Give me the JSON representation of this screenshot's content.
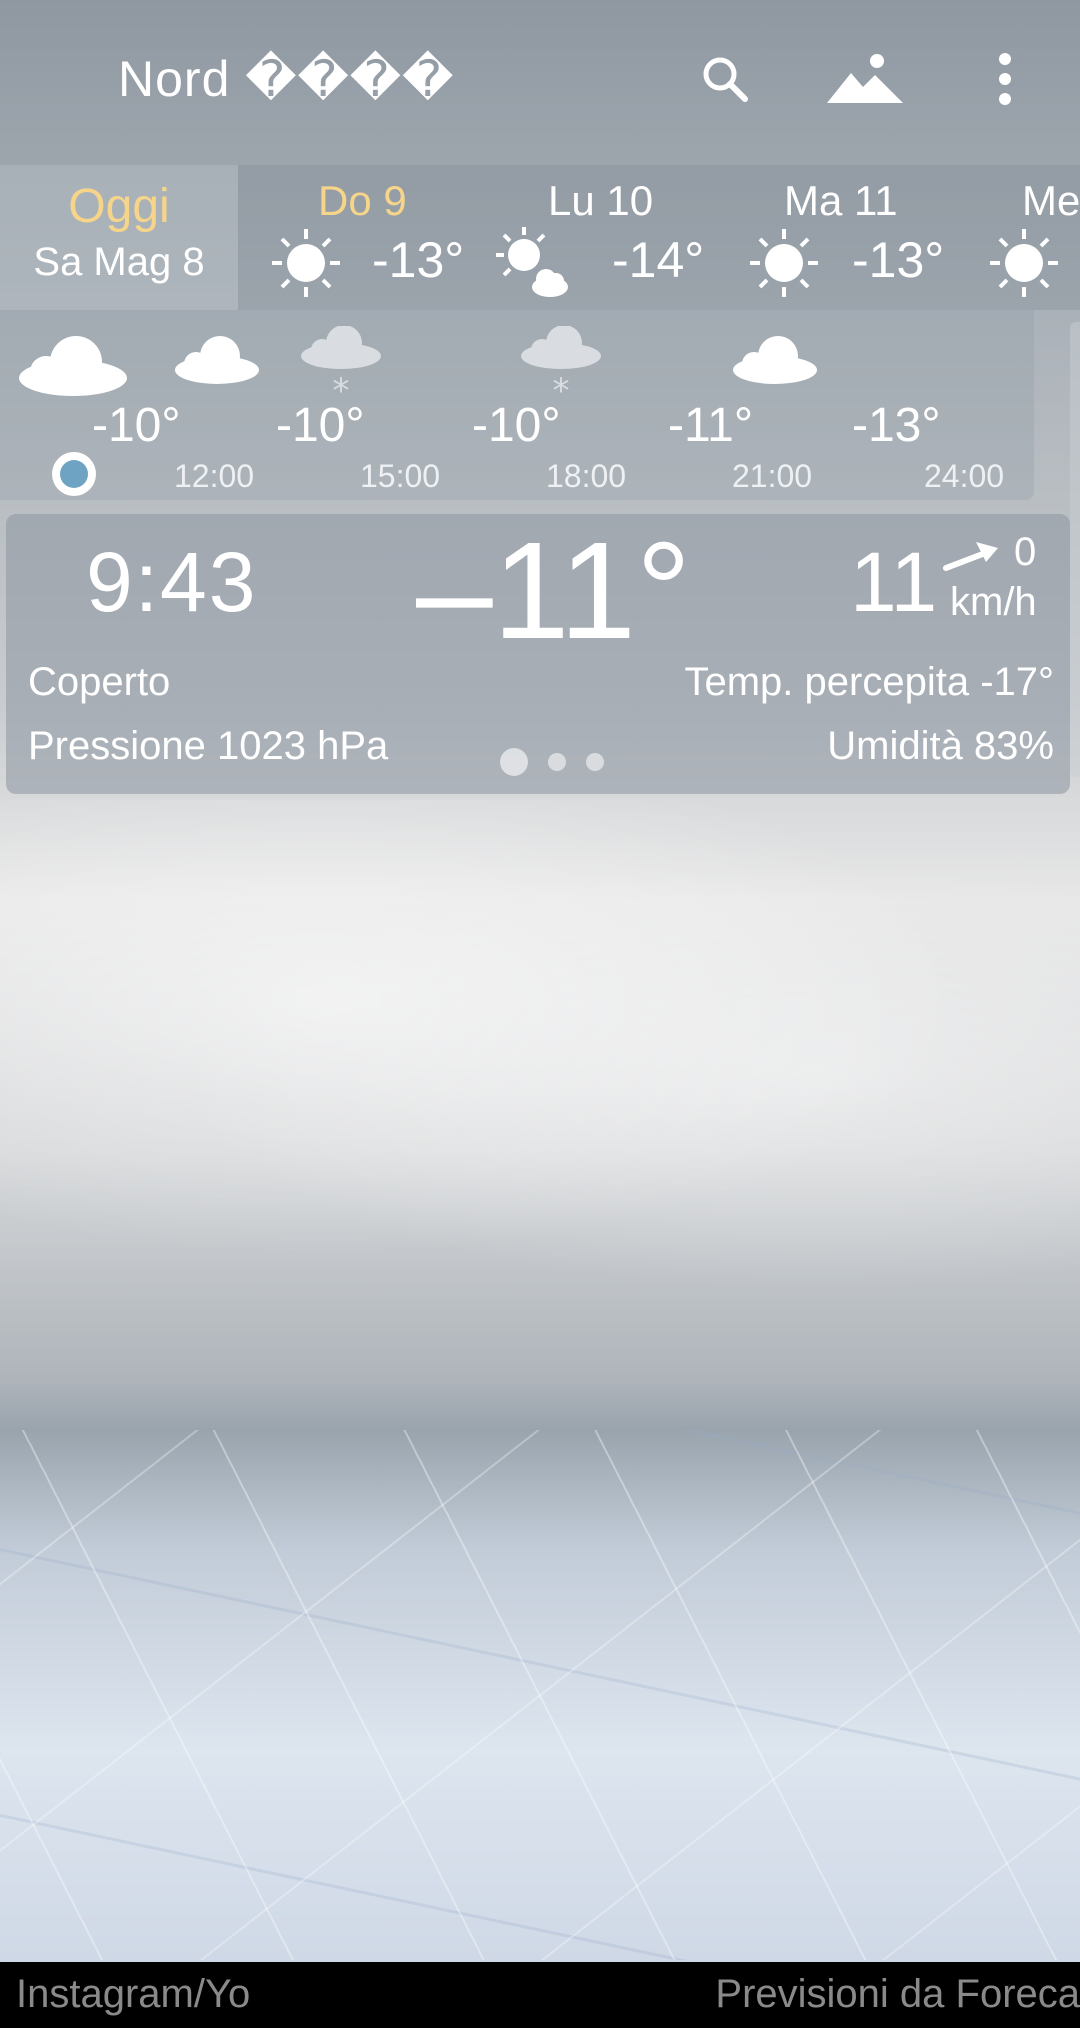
{
  "header": {
    "title": "Nord ����",
    "search_icon": "search-icon",
    "landscape_icon": "landscape-icon",
    "more_icon": "more-vert-icon"
  },
  "daily": {
    "today": {
      "label": "Oggi",
      "date": "Sa Mag 8"
    },
    "days": [
      {
        "name": "Do 9",
        "icon": "sun-icon",
        "temp": "-13°",
        "highlight": true
      },
      {
        "name": "Lu 10",
        "icon": "sun-cloud-icon",
        "temp": "-14°"
      },
      {
        "name": "Ma 11",
        "icon": "sun-icon",
        "temp": "-13°"
      },
      {
        "name": "Me",
        "icon": "sun-icon",
        "temp": ""
      }
    ]
  },
  "hourly": {
    "temps": [
      "-10°",
      "-10°",
      "-10°",
      "-11°",
      "-13°"
    ],
    "times": [
      "12:00",
      "15:00",
      "18:00",
      "21:00",
      "24:00"
    ],
    "icons": [
      "cloud-icon",
      "cloud-icon",
      "snow-cloud-icon",
      "snow-cloud-icon",
      "cloud-icon",
      "cloud-icon"
    ]
  },
  "current": {
    "time": "9:43",
    "temperature": "–11°",
    "wind_speed": "11",
    "wind_gust": "0",
    "wind_unit": "km/h",
    "condition": "Coperto",
    "feels_like": "Temp. percepita -17°",
    "pressure": "Pressione 1023 hPa",
    "humidity": "Umidità 83%",
    "page_index": 1,
    "page_count": 3
  },
  "footer": {
    "credit_left": "Instagram/Yo",
    "credit_right": "Previsioni da Foreca"
  },
  "colors": {
    "highlight_day": "#f6d58a",
    "now_marker": "#6ea3c4"
  }
}
